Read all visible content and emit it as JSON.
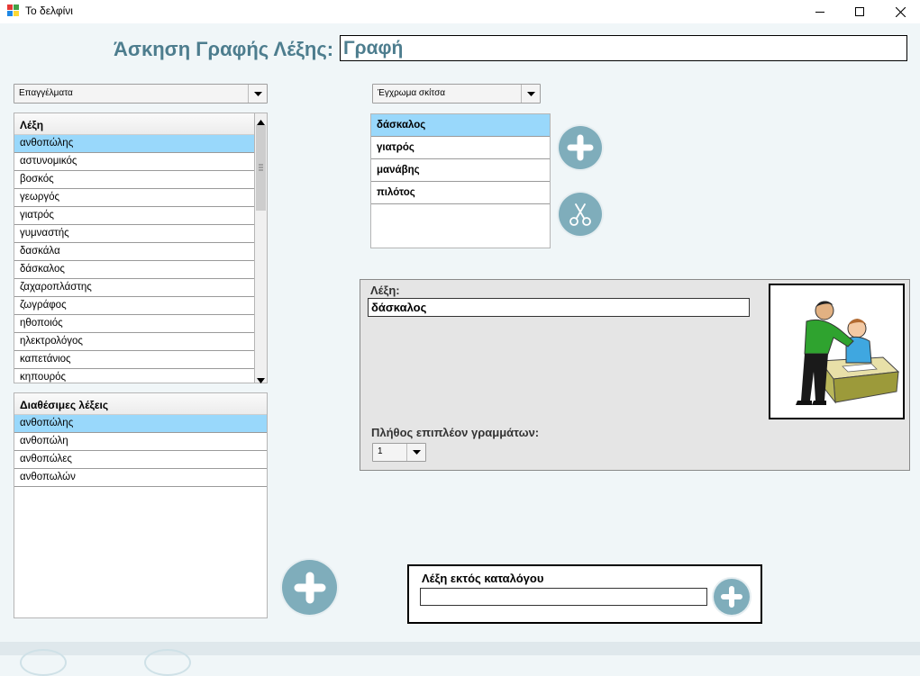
{
  "window": {
    "title": "Το δελφίνι",
    "controls": [
      "minimize-icon",
      "maximize-icon",
      "close-icon"
    ]
  },
  "heading": {
    "label": "Άσκηση Γραφής Λέξης:",
    "value": "Γραφή"
  },
  "category_select": {
    "selected": "Επαγγέλματα"
  },
  "image_style_select": {
    "selected": "Έγχρωμα σκίτσα"
  },
  "word_list": {
    "header": "Λέξη",
    "items": [
      "ανθοπώλης",
      "αστυνομικός",
      "βοσκός",
      "γεωργός",
      "γιατρός",
      "γυμναστής",
      "δασκάλα",
      "δάσκαλος",
      "ζαχαροπλάστης",
      "ζωγράφος",
      "ηθοποιός",
      "ηλεκτρολόγος",
      "καπετάνιος",
      "κηπουρός"
    ],
    "selected_index": 0
  },
  "available_words": {
    "header": "Διαθέσιμες λέξεις",
    "items": [
      "ανθοπώλης",
      "ανθοπώλη",
      "ανθοπώλες",
      "ανθοπωλών"
    ],
    "selected_index": 0
  },
  "exercise_words": {
    "items": [
      "δάσκαλος",
      "γιατρός",
      "μανάβης",
      "πιλότος"
    ],
    "selected_index": 0
  },
  "detail_panel": {
    "word_label": "Λέξη:",
    "word_value": "δάσκαλος",
    "extra_letters_label": "Πλήθος επιπλέον γραμμάτων:",
    "extra_letters_value": "1"
  },
  "out_of_catalog": {
    "label": "Λέξη εκτός καταλόγου",
    "value": ""
  },
  "colors": {
    "accent": "#4d7d8e",
    "button": "#7fadbb",
    "selection": "#99d8fb"
  }
}
